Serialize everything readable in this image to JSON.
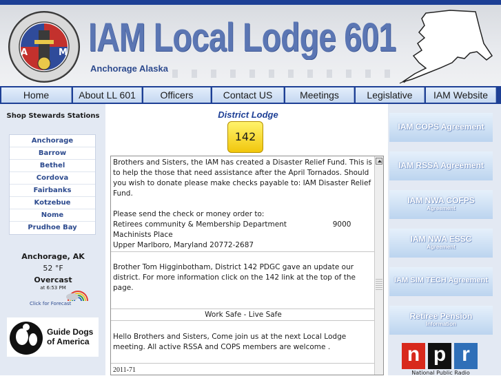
{
  "banner": {
    "title": "IAM Local Lodge 601",
    "subtitle": "Anchorage Alaska",
    "seal_letters": [
      "A",
      "M"
    ],
    "seal_text": "INTERNATIONAL ASSOCIATION OF MACHINISTS AND AEROSPACE WORKERS"
  },
  "nav": {
    "items": [
      "Home",
      "About LL 601",
      "Officers",
      "Contact US",
      "Meetings",
      "Legislative",
      "IAM Website"
    ]
  },
  "left": {
    "title": "Shop Stewards Stations",
    "stations": [
      "Anchorage",
      "Barrow",
      "Bethel",
      "Cordova",
      "Fairbanks",
      "Kotzebue",
      "Nome",
      "Prudhoe Bay"
    ],
    "weather": {
      "city": "Anchorage, AK",
      "temp": "52 °F",
      "condition": "Overcast",
      "time": "at 6:53 PM",
      "forecast_link": "Click for Forecast"
    },
    "guide_dogs": {
      "line1": "Guide Dogs",
      "line2": "of America"
    }
  },
  "center": {
    "title": "District Lodge",
    "badge": "142",
    "news": [
      {
        "lines": [
          "Brothers and Sisters, the IAM has created a Disaster Relief Fund. This is to help the those that need assistance after the April Tornados. Should you wish to donate please make checks payable to: IAM Disaster Relief Fund.",
          "",
          "Please send the check or money order to:",
          "Retirees community & Membership Department                    9000 Machinists Place",
          "Upper Marlboro, Maryland 20772-2687"
        ]
      },
      {
        "lines": [
          "Brother Tom Higginbotham, District 142 PDGC gave an update our district. For more information click on the 142 link at the top of the page."
        ]
      },
      {
        "lines": [
          "Work Safe - Live Safe"
        ]
      },
      {
        "lines": [
          "Hello Brothers and Sisters, Come join us at the next Local Lodge meeting. All active RSSA and COPS members are welcome ."
        ]
      },
      {
        "lines": [
          "2011-71"
        ]
      }
    ]
  },
  "right": {
    "agreements": [
      {
        "line1": "IAM COPS Agreement",
        "line2": ""
      },
      {
        "line1": "IAM RSSA Agreement",
        "line2": ""
      },
      {
        "line1": "IAM NWA COFPS",
        "line2": "Agreement"
      },
      {
        "line1": "IAM NWA ESSC",
        "line2": "Agreement"
      },
      {
        "line1": "IAM SIM TECH Agreement",
        "line2": ""
      },
      {
        "line1": "Retiree Pension",
        "line2": "Information"
      }
    ],
    "npr": {
      "letters": [
        "n",
        "p",
        "r"
      ],
      "caption": "National Public Radio"
    }
  },
  "colors": {
    "nav_bg": "#1d3f95",
    "banner_title": "#5b76b3",
    "badge": "#f1c70d",
    "npr_red": "#d8291c",
    "npr_black": "#111111",
    "npr_blue": "#2f6fb8"
  }
}
